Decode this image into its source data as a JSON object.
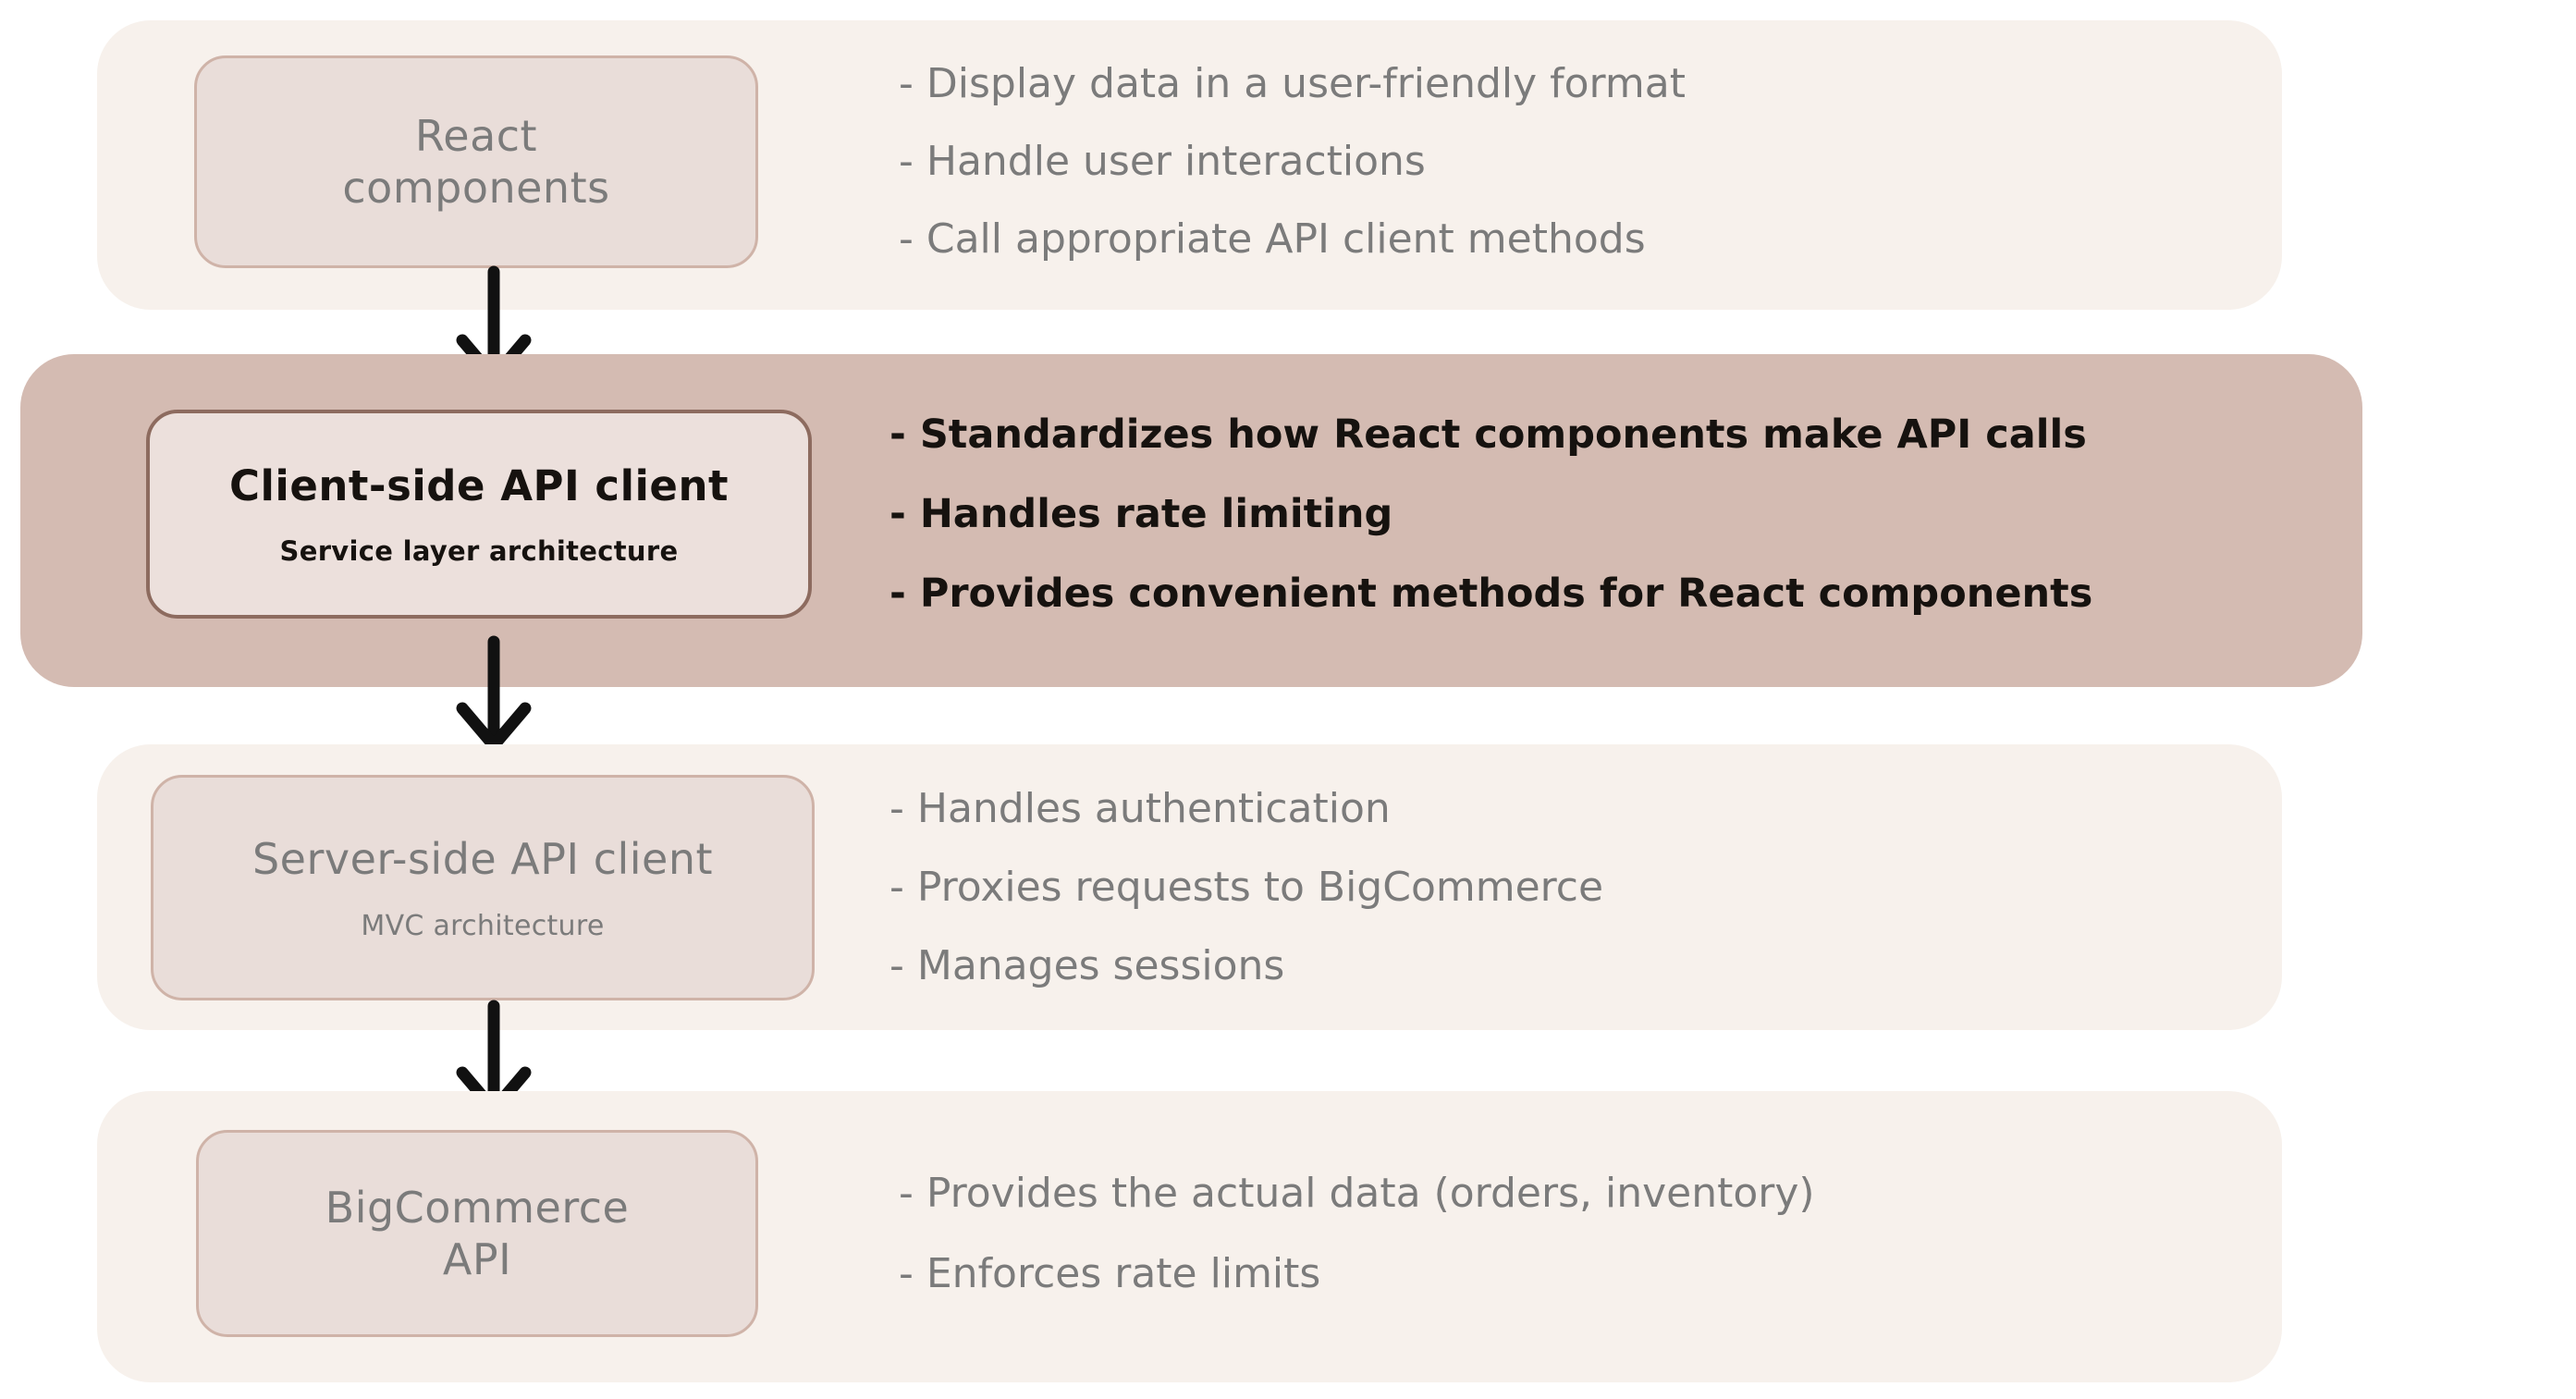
{
  "diagram": {
    "title": "API client layered architecture flow",
    "colors": {
      "band_normal": "#f7f1ec",
      "band_highlight": "#d4bbb2",
      "node_fill": "#e9ddd9",
      "node_border": "#cfb3a8",
      "node_border_emphasis": "#8d6b5f",
      "text_muted": "#7b7b7b",
      "text_strong": "#16120f",
      "arrow": "#111111"
    },
    "layers": [
      {
        "id": "react-components",
        "highlighted": false,
        "node": {
          "title": "React\ncomponents",
          "subtitle": ""
        },
        "bullets": [
          "- Display data in a user-friendly format",
          "- Handle user interactions",
          "- Call appropriate API client methods"
        ]
      },
      {
        "id": "client-side-api-client",
        "highlighted": true,
        "node": {
          "title": "Client-side API client",
          "subtitle": "Service layer architecture"
        },
        "bullets": [
          "- Standardizes how React components make API calls",
          "- Handles rate limiting",
          "- Provides convenient methods for React components"
        ]
      },
      {
        "id": "server-side-api-client",
        "highlighted": false,
        "node": {
          "title": "Server-side API client",
          "subtitle": "MVC architecture"
        },
        "bullets": [
          "- Handles authentication",
          "- Proxies requests to BigCommerce",
          "- Manages sessions"
        ]
      },
      {
        "id": "bigcommerce-api",
        "highlighted": false,
        "node": {
          "title": "BigCommerce\nAPI",
          "subtitle": ""
        },
        "bullets": [
          "- Provides the actual data (orders, inventory)",
          "- Enforces rate limits"
        ]
      }
    ],
    "arrows": [
      {
        "id": "arrow-react-to-client",
        "from": "react-components",
        "to": "client-side-api-client"
      },
      {
        "id": "arrow-client-to-server",
        "from": "client-side-api-client",
        "to": "server-side-api-client"
      },
      {
        "id": "arrow-server-to-bigcommerce",
        "from": "server-side-api-client",
        "to": "bigcommerce-api"
      }
    ]
  }
}
